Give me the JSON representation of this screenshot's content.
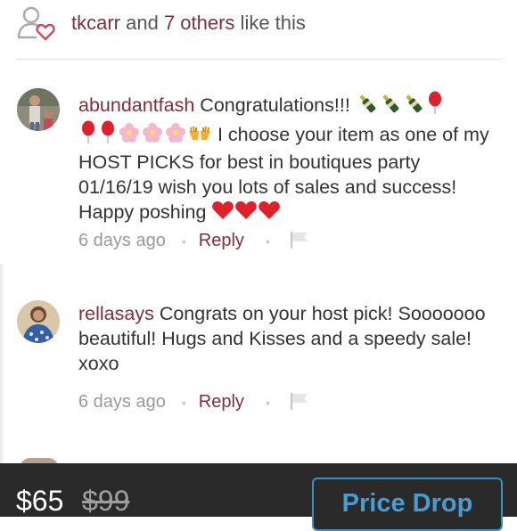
{
  "likes": {
    "user": "tkcarr",
    "connector": " and ",
    "others": "7 others",
    "suffix": " like this"
  },
  "comments": [
    {
      "username": "abundantfash",
      "text_line1": " Congratulations!!! ",
      "text_line2_tail": " I choose your item as one of my HOST PICKS for best in boutiques party 01/16/19 wish you lots of sales and success! Happy poshing ",
      "time": "6 days ago",
      "reply": "Reply"
    },
    {
      "username": "rellasays",
      "text": " Congrats on your host pick! Sooooooo beautiful! Hugs and Kisses and a speedy sale! xoxo",
      "time": "6 days ago",
      "reply": "Reply"
    }
  ],
  "footer": {
    "price": "$65",
    "original_price": "$99",
    "price_drop_label": "Price Drop"
  },
  "colors": {
    "username": "#7f2f3a",
    "bottom_bar": "#2a2a2a",
    "price_drop": "#4a9bd3"
  },
  "icons": {
    "likes": "user-heart-icon",
    "flag": "flag-icon"
  }
}
